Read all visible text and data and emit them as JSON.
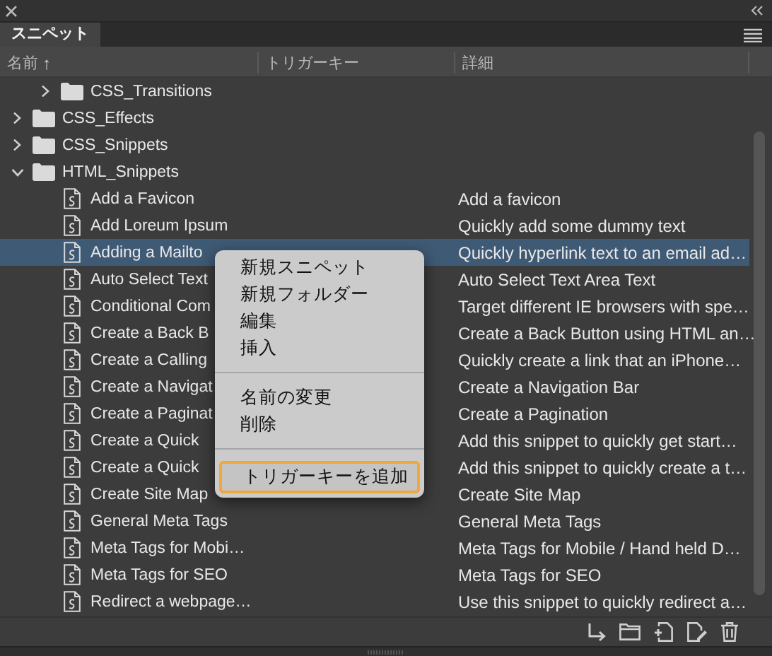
{
  "panel": {
    "tab": {
      "label": "スニペット",
      "selected": true
    },
    "columns": [
      {
        "label": "名前",
        "sort_arrow": "↑"
      },
      {
        "label": "トリガーキー"
      },
      {
        "label": "詳細"
      }
    ],
    "tree": [
      {
        "children": [
          {
            "kind": "folder",
            "name": "CSS_Transitions",
            "expanded": false,
            "selected": false
          }
        ]
      },
      {
        "kind": "folder",
        "name": "CSS_Effects",
        "expanded": false,
        "selected": false
      },
      {
        "kind": "folder",
        "name": "CSS_Snippets",
        "expanded": false,
        "selected": false
      },
      {
        "kind": "folder",
        "name": "HTML_Snippets",
        "expanded": true,
        "selected": false,
        "children": [
          {
            "kind": "snippet",
            "name": "Add a Favicon",
            "description": "Add a favicon",
            "selected": false
          },
          {
            "kind": "snippet",
            "name": "Add Loreum Ipsum",
            "description": "Quickly add some dummy text",
            "selected": false
          },
          {
            "kind": "snippet",
            "name": "Adding a Mailto",
            "description": "Quickly hyperlink text to an email ad…",
            "selected": true
          },
          {
            "kind": "snippet",
            "name": "Auto Select Text",
            "description": "Auto Select Text Area Text",
            "selected": false
          },
          {
            "kind": "snippet",
            "name": "Conditional Com",
            "description": "Target different IE browsers with spe…",
            "selected": false
          },
          {
            "kind": "snippet",
            "name": "Create a Back B",
            "description": "Create a Back Button using HTML an…",
            "selected": false
          },
          {
            "kind": "snippet",
            "name": "Create a Calling",
            "description": "Quickly create a link that an iPhone…",
            "selected": false
          },
          {
            "kind": "snippet",
            "name": "Create a Navigat",
            "description": "Create a Navigation Bar",
            "selected": false
          },
          {
            "kind": "snippet",
            "name": "Create a Paginat",
            "description": "Create a Pagination",
            "selected": false
          },
          {
            "kind": "snippet",
            "name": "Create a Quick",
            "description": "Add this snippet to quickly get start…",
            "selected": false
          },
          {
            "kind": "snippet",
            "name": "Create a Quick",
            "description": "Add this snippet to quickly create a t…",
            "selected": false
          },
          {
            "kind": "snippet",
            "name": "Create Site Map",
            "description": "Create Site Map",
            "selected": false
          },
          {
            "kind": "snippet",
            "name": "General Meta Tags",
            "description": "General Meta Tags",
            "selected": false
          },
          {
            "kind": "snippet",
            "name": "Meta Tags for Mobi…",
            "description": "Meta Tags for Mobile / Hand held D…",
            "selected": false
          },
          {
            "kind": "snippet",
            "name": "Meta Tags for SEO",
            "description": "Meta Tags for SEO",
            "selected": false
          },
          {
            "kind": "snippet",
            "name": "Redirect a webpage…",
            "description": "Use this snippet to quickly redirect a…",
            "selected": false
          }
        ]
      }
    ]
  },
  "context_menu": {
    "groups": [
      [
        {
          "label": "新規スニペット",
          "selected": false
        },
        {
          "label": "新規フォルダー",
          "selected": false
        },
        {
          "label": "編集",
          "selected": false
        },
        {
          "label": "挿入",
          "selected": false
        }
      ],
      [
        {
          "label": "名前の変更",
          "selected": false
        },
        {
          "label": "削除",
          "selected": false
        }
      ],
      [
        {
          "label": "トリガーキーを追加",
          "selected": true
        }
      ]
    ]
  }
}
